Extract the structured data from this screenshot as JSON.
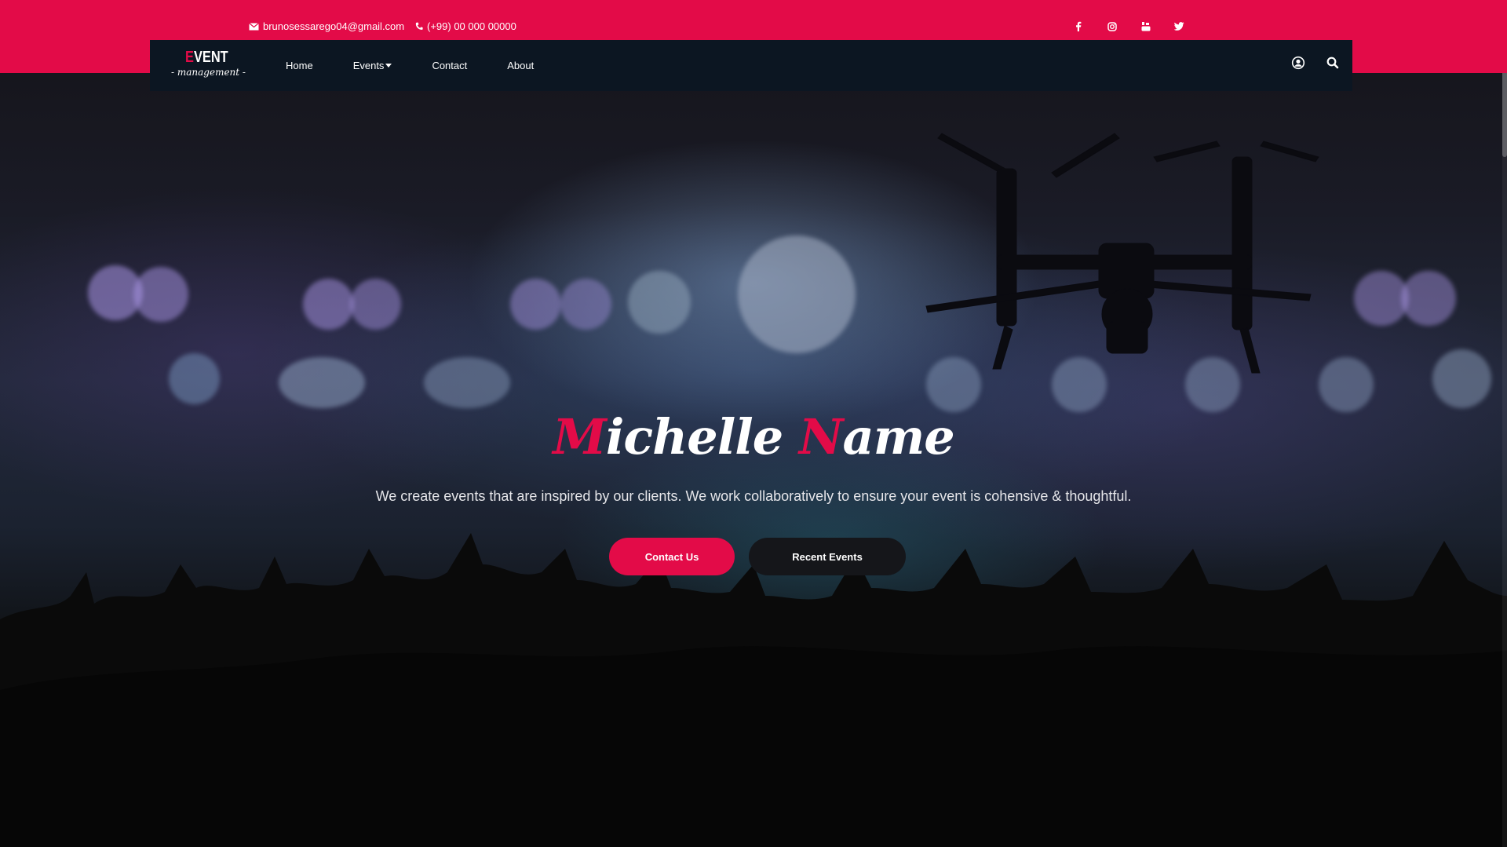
{
  "topbar": {
    "email": "brunosessarego04@gmail.com",
    "phone": "(+99) 00 000 00000",
    "social": [
      "facebook-icon",
      "instagram-icon",
      "youtube-icon",
      "twitter-icon"
    ]
  },
  "navbar": {
    "logo": {
      "word": "VENT",
      "initial": "E",
      "sub": "- management -"
    },
    "links": [
      {
        "label": "Home"
      },
      {
        "label": "Events"
      },
      {
        "label": "Contact"
      },
      {
        "label": "About"
      }
    ]
  },
  "hero": {
    "title_first_initial": "M",
    "title_first_rest": "ichelle",
    "title_second_initial": "N",
    "title_second_rest": "ame",
    "subtitle": "We create events that are inspired by our clients. We work collaboratively to ensure your event is cohensive & thoughtful.",
    "contact_button": "Contact Us",
    "recent_button": "Recent Events"
  },
  "colors": {
    "accent": "#e30b48",
    "navbar": "#0c1622",
    "dark_button": "#15161a"
  }
}
